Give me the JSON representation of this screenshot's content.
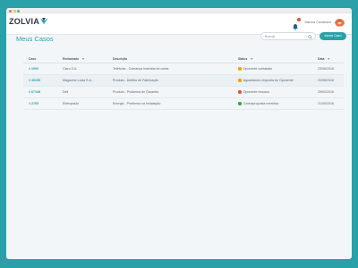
{
  "colors": {
    "background": "#2aa1a8",
    "accent": "#2aa1a8",
    "status_orange": "#f59e0b",
    "status_red": "#e54d3c",
    "status_green": "#2ea84a"
  },
  "brand": {
    "name": "ZOLVIA"
  },
  "user": {
    "name": "Marcos Cavalcanti",
    "avatar": "avatar-icon"
  },
  "page": {
    "title": "Meus Casos",
    "search_placeholder": "Buscar",
    "new_button": "Iniciar Caso"
  },
  "table": {
    "headers": [
      "Caso",
      "Reclamado",
      "Descrição",
      "Status",
      "Data"
    ],
    "rows": [
      {
        "caso": "# 2606",
        "reclamado": "Claro S.A.",
        "descricao": "Telefonia - Cobrança indevida de conta",
        "status": "Oponente contatado",
        "status_color": "#f59e0b",
        "data": "23/06/2016"
      },
      {
        "caso": "# 45199",
        "reclamado": "Magazine Luiza S.A.",
        "descricao": "Produto - Defeito de Fabricação",
        "status": "Aguardando resposta do Oponente",
        "status_color": "#f59e0b",
        "data": "20/06/2016"
      },
      {
        "caso": "# 67138",
        "reclamado": "Dell",
        "descricao": "Produto - Problema de Garantia",
        "status": "Oponente recusou",
        "status_color": "#e54d3c",
        "data": "29/02/2016"
      },
      {
        "caso": "# 2705",
        "reclamado": "Eletropaulo",
        "descricao": "Energia - Problema na Instalação",
        "status": "Contraproposta recebida",
        "status_color": "#2ea84a",
        "data": "21/05/2016"
      }
    ]
  }
}
